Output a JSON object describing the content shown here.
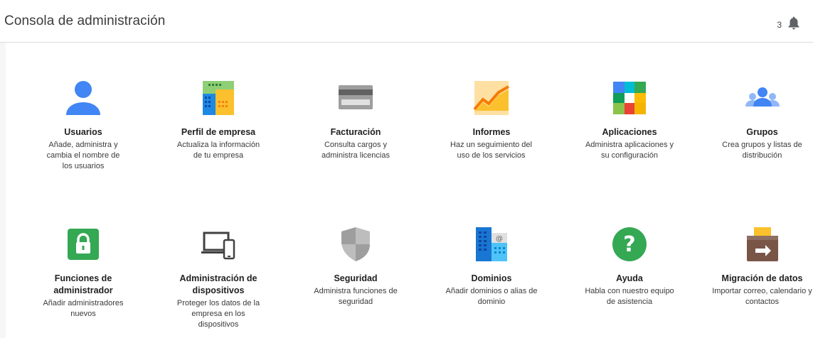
{
  "header": {
    "title": "Consola de administración",
    "notification_count": "3"
  },
  "tiles": [
    {
      "name": "Usuarios",
      "desc": "Añade, administra y cambia el nombre de los usuarios",
      "icon": "users-icon"
    },
    {
      "name": "Perfil de empresa",
      "desc": "Actualiza la información de tu empresa",
      "icon": "company-profile-icon"
    },
    {
      "name": "Facturación",
      "desc": "Consulta cargos y administra licencias",
      "icon": "billing-card-icon"
    },
    {
      "name": "Informes",
      "desc": "Haz un seguimiento del uso de los servicios",
      "icon": "reports-chart-icon"
    },
    {
      "name": "Aplicaciones",
      "desc": "Administra aplicaciones y su configuración",
      "icon": "apps-grid-icon"
    },
    {
      "name": "Grupos",
      "desc": "Crea grupos y listas de distribución",
      "icon": "groups-icon"
    },
    {
      "name": "Funciones de administrador",
      "desc": "Añadir administradores nuevos",
      "icon": "admin-lock-icon"
    },
    {
      "name": "Administración de dispositivos",
      "desc": "Proteger los datos de la empresa en los dispositivos",
      "icon": "devices-icon"
    },
    {
      "name": "Seguridad",
      "desc": "Administra funciones de seguridad",
      "icon": "security-shield-icon"
    },
    {
      "name": "Dominios",
      "desc": "Añadir dominios o alias de dominio",
      "icon": "domains-icon"
    },
    {
      "name": "Ayuda",
      "desc": "Habla con nuestro equipo de asistencia",
      "icon": "help-icon"
    },
    {
      "name": "Migración de datos",
      "desc": "Importar correo, calendario y contactos",
      "icon": "data-migration-icon"
    }
  ],
  "colors": {
    "user_blue": "#4285f4",
    "admin_green": "#34a853",
    "help_green": "#34a853",
    "chart_orange": "#f6a623"
  }
}
